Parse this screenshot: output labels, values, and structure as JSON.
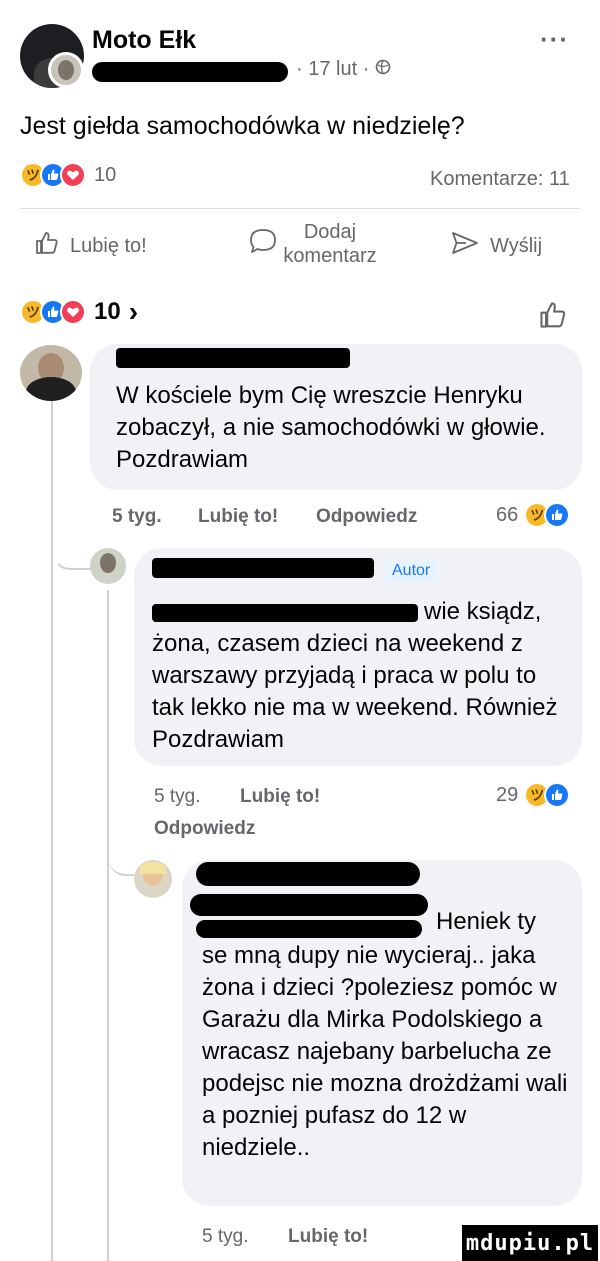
{
  "post": {
    "group_name": "Moto Ełk",
    "more": "···",
    "meta": "· 17 lut ·",
    "text": "Jest giełda samochodówka w niedzielę?",
    "reaction_count": "10",
    "comments_count": "Komentarze: 11"
  },
  "actions": {
    "like": "Lubię to!",
    "comment_line1": "Dodaj",
    "comment_line2": "komentarz",
    "share": "Wyślij"
  },
  "summary": {
    "reaction_count": "10",
    "chevron": "›"
  },
  "comments": [
    {
      "text": "W kościele bym Cię wreszcie Henryku zobaczył, a nie samochodówki w głowie. Pozdrawiam",
      "time": "5 tyg.",
      "like": "Lubię to!",
      "reply": "Odpowiedz",
      "reactions": "66"
    },
    {
      "badge": "Autor",
      "text_line1": "wie ksiądz,",
      "text": "żona, czasem dzieci na weekend z warszawy przyjadą i praca w polu to tak lekko nie ma w weekend. Również Pozdrawiam",
      "time": "5 tyg.",
      "like": "Lubię to!",
      "reply": "Odpowiedz",
      "reactions": "29"
    },
    {
      "text_line1": "Heniek ty",
      "text": "se mną dupy nie wycieraj.. jaka żona i dzieci ?poleziesz pomóc w Garażu dla Mirka Podolskiego a wracasz najebany barbelucha ze podejsc nie mozna drożdżami wali a pozniej pufasz do 12 w niedziele..",
      "time": "5 tyg.",
      "like": "Lubię to!"
    }
  ],
  "watermark": "mdupiu.pl",
  "colors": {
    "facebook_blue": "#1877f2",
    "bubble": "#f0f2f5",
    "muted": "#65676b"
  },
  "icons": [
    "thumbs-up-icon",
    "comment-icon",
    "share-icon",
    "globe-icon",
    "haha-reaction-icon",
    "like-reaction-icon",
    "love-reaction-icon"
  ]
}
